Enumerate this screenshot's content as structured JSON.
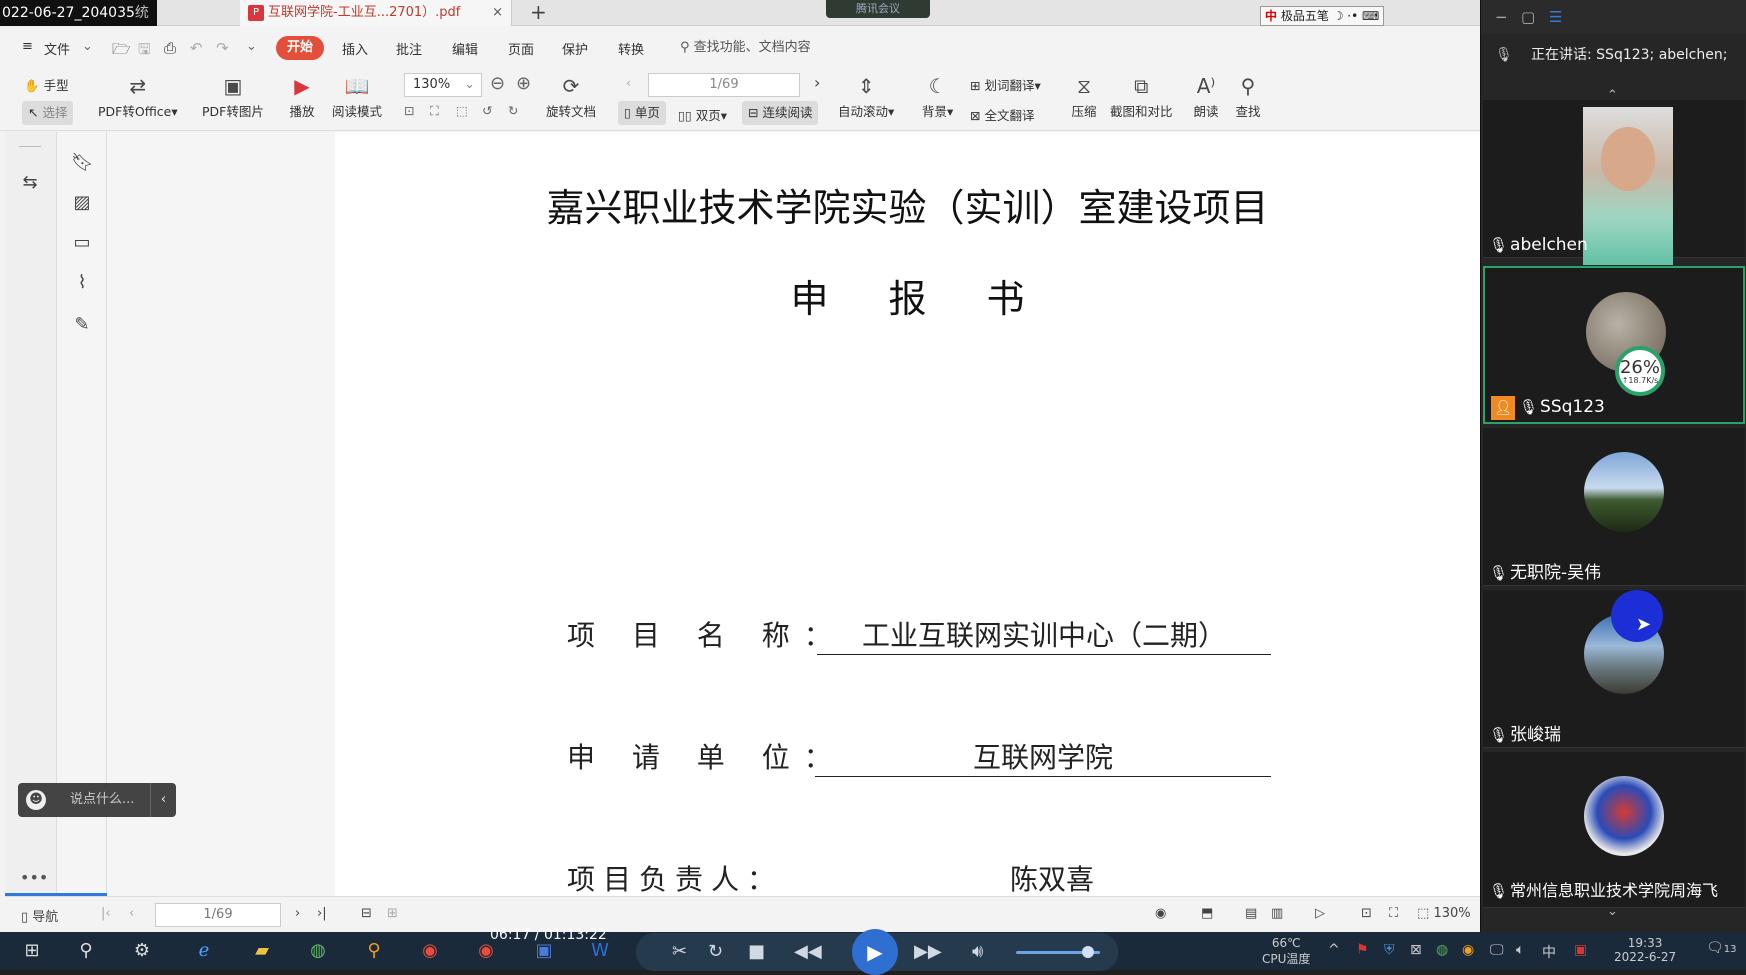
{
  "recording_stamp": "022-06-27_204035",
  "tab": {
    "stamp_suffix": "统",
    "file_icon": "P",
    "title": "互联网学院-工业互...2701）.pdf",
    "close": "×",
    "new_tab": "+"
  },
  "meeting_badge": "腾讯会议",
  "ime": {
    "logo": "中",
    "label": "极品五笔",
    "moon": "☽",
    "dots": "·•",
    "kb": "⌨"
  },
  "menu": {
    "hamburger": "≡",
    "file": "文件",
    "start": "开始",
    "items": [
      "插入",
      "批注",
      "编辑",
      "页面",
      "保护",
      "转换"
    ],
    "search": "查找功能、文档内容"
  },
  "ribbon": {
    "hand": "手型",
    "select": "选择",
    "pdf_to_office": "PDF转Office",
    "pdf_to_image": "PDF转图片",
    "play": "播放",
    "read_mode": "阅读模式",
    "zoom": "130%",
    "rotate": "旋转文档",
    "page": "1/69",
    "single": "单页",
    "double": "双页",
    "continuous": "连续阅读",
    "autoscroll": "自动滚动",
    "background": "背景",
    "word_translate": "划词翻译",
    "full_translate": "全文翻译",
    "compress": "压缩",
    "screenshot_compare": "截图和对比",
    "read_aloud": "朗读",
    "find": "查找"
  },
  "chat": {
    "placeholder": "说点什么...",
    "arrow": "‹"
  },
  "more": "•••",
  "document": {
    "title": "嘉兴职业技术学院实验（实训）室建设项目",
    "subtitle": "申报书",
    "fields": [
      {
        "label": "项 目 名 称：",
        "value": "工业互联网实训中心（二期）"
      },
      {
        "label": "申 请 单 位：",
        "value": "互联网学院"
      },
      {
        "label": "项目负责人：",
        "value": "陈双喜"
      }
    ]
  },
  "statusbar": {
    "nav": "导航",
    "page": "1/69",
    "zoom": "130%"
  },
  "meeting": {
    "speaking": "正在讲话: SSq123; abelchen;",
    "participants": [
      {
        "name": "abelchen"
      },
      {
        "name": "SSq123",
        "stat_percent": "26%",
        "stat_rate": "↑18.7K/s"
      },
      {
        "name": "无职院-吴伟"
      },
      {
        "name": "张峻瑞"
      },
      {
        "name": "常州信息职业技术学院周海飞"
      }
    ]
  },
  "player": {
    "time": "06:17 / 01:13:22"
  },
  "tray": {
    "temp": "66℃",
    "temp_label": "CPU温度",
    "ime": "中",
    "time": "19:33",
    "date": "2022-6-27",
    "notif": "13"
  }
}
